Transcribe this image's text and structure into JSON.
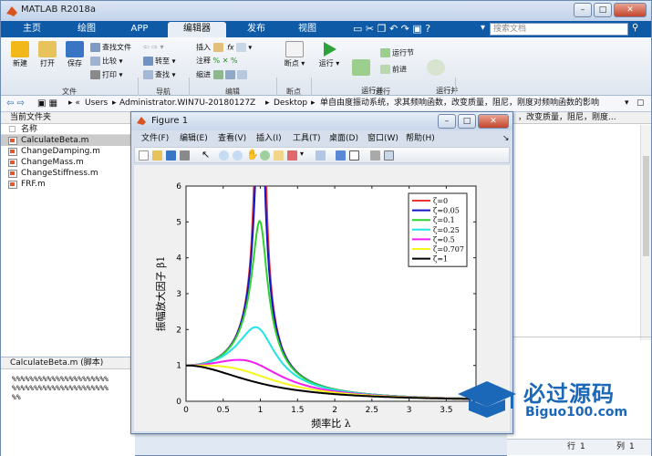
{
  "app": {
    "title": "MATLAB R2018a",
    "tabs": [
      "主页",
      "绘图",
      "APP",
      "编辑器",
      "发布",
      "视图"
    ],
    "active_tab": "编辑器",
    "search_placeholder": "搜索文档"
  },
  "ribbon": {
    "file_group": {
      "label": "文件",
      "new": "新建",
      "open": "打开",
      "save": "保存",
      "find_files": "查找文件",
      "compare": "比较",
      "print": "打印"
    },
    "nav_group": {
      "label": "导航",
      "goto": "转至",
      "find": "查找"
    },
    "edit_group": {
      "label": "编辑",
      "insert": "插入",
      "comment": "注释",
      "indent": "缩进",
      "fx": "fx"
    },
    "breakpoints_group": {
      "label": "断点",
      "breakpoint": "断点"
    },
    "run_group": {
      "label": "运行",
      "run": "运行",
      "run_advance": "运行并\n前进",
      "run_section": "运行节",
      "advance": "前进",
      "run_time": "运行并\n计时"
    }
  },
  "path": {
    "segments": [
      "Users",
      "Administrator.WIN7U-20180127Z",
      "Desktop",
      "单自由度振动系统，求其频响函数，改变质量，阻尼，刚度对频响函数的影响"
    ]
  },
  "current_folder": {
    "title": "当前文件夹",
    "column_name": "名称",
    "files": [
      "CalculateBeta.m",
      "ChangeDamping.m",
      "ChangeMass.m",
      "ChangeStiffness.m",
      "FRF.m"
    ],
    "selected_file": "CalculateBeta.m"
  },
  "details": {
    "title": "CalculateBeta.m (脚本)",
    "lines": [
      "%%%%%%%%%%%%%%%%%%%%%%",
      "%%%%%%%%%%%%%%%%%%%%%%",
      "%%"
    ]
  },
  "right_panel": {
    "partial_title": "，改变质量，阻尼，刚度..."
  },
  "figure": {
    "title": "Figure 1",
    "menu": [
      "文件(F)",
      "编辑(E)",
      "查看(V)",
      "插入(I)",
      "工具(T)",
      "桌面(D)",
      "窗口(W)",
      "帮助(H)"
    ]
  },
  "status": {
    "line_label": "行",
    "line_value": "1",
    "col_label": "列",
    "col_value": "1"
  },
  "watermark": {
    "text": "必过源码",
    "url": "Biguo100.com"
  },
  "colors": {
    "tabbar": "#0f5aa6",
    "zeta_0": "#e8382f",
    "zeta_0_05": "#1414c8",
    "zeta_0_1": "#2fd12f",
    "zeta_0_25": "#22e4e4",
    "zeta_0_5": "#f21ef2",
    "zeta_0_707": "#f7f71c",
    "zeta_1": "#000000"
  },
  "chart_data": {
    "type": "line",
    "title": "",
    "xlabel": "频率比 λ",
    "ylabel": "振幅放大因子 β1",
    "xlim": [
      0,
      3.9
    ],
    "ylim": [
      0,
      6
    ],
    "xticks": [
      0,
      0.5,
      1,
      1.5,
      2,
      2.5,
      3,
      3.5
    ],
    "xtick_labels": [
      "0",
      "0.5",
      "1",
      "1.5",
      "2",
      "2.5",
      "3",
      "3.5"
    ],
    "yticks": [
      0,
      1,
      2,
      3,
      4,
      5,
      6
    ],
    "ytick_labels": [
      "0",
      "1",
      "2",
      "3",
      "4",
      "5",
      "6"
    ],
    "grid": false,
    "legend_position": "top-right",
    "formula": "beta = 1 / sqrt((1 - lambda^2)^2 + (2*zeta*lambda)^2)",
    "series": [
      {
        "name": "ζ=0",
        "zeta": 0,
        "peak": 6.0
      },
      {
        "name": "ζ=0.05",
        "zeta": 0.05,
        "peak": 6.0
      },
      {
        "name": "ζ=0.1",
        "zeta": 0.1,
        "peak": 5.0
      },
      {
        "name": "ζ=0.25",
        "zeta": 0.25,
        "peak": 2.07
      },
      {
        "name": "ζ=0.5",
        "zeta": 0.5,
        "peak": 1.15
      },
      {
        "name": "ζ=0.707",
        "zeta": 0.707,
        "peak": 1.0
      },
      {
        "name": "ζ=1",
        "zeta": 1,
        "peak": 1.0
      }
    ],
    "sample_points": {
      "lambda": [
        0,
        0.5,
        0.9,
        1.0,
        1.5,
        2.0,
        3.0
      ],
      "zeta_0.25": [
        1.0,
        1.21,
        1.84,
        2.0,
        0.67,
        0.31,
        0.12
      ],
      "zeta_0.5": [
        1.0,
        1.1,
        0.99,
        1.0,
        0.48,
        0.28,
        0.12
      ],
      "zeta_1": [
        1.0,
        0.8,
        0.55,
        0.5,
        0.31,
        0.2,
        0.1
      ]
    }
  }
}
